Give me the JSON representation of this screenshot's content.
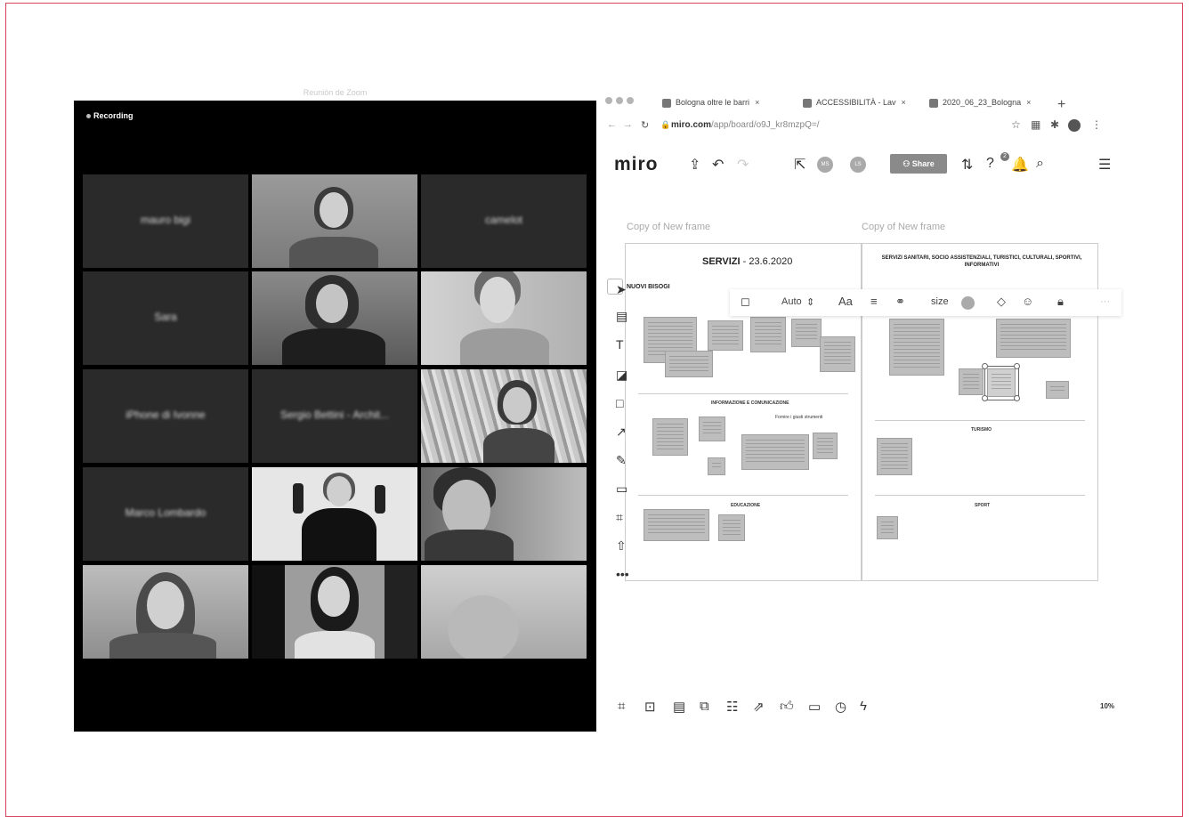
{
  "zoom": {
    "window_title": "Reunión de Zoom",
    "recording_label": "Recording",
    "participants": [
      {
        "name": "mauro bigi"
      },
      {
        "name": ""
      },
      {
        "name": "camelot"
      },
      {
        "name": "Sara"
      },
      {
        "name": ""
      },
      {
        "name": ""
      },
      {
        "name": "iPhone di Ivonne"
      },
      {
        "name": "Sergio Bettini - Archit..."
      },
      {
        "name": ""
      },
      {
        "name": "Marco Lombardo"
      },
      {
        "name": ""
      },
      {
        "name": ""
      },
      {
        "name": ""
      },
      {
        "name": ""
      },
      {
        "name": ""
      }
    ]
  },
  "browser": {
    "tabs": [
      {
        "label": "Bologna oltre le barri",
        "close": "×"
      },
      {
        "label": "ACCESSIBILITÀ - Lav",
        "close": "×"
      },
      {
        "label": "2020_06_23_Bologna",
        "close": "×"
      }
    ],
    "new_tab": "+",
    "url_domain": "miro.com",
    "url_path": "/app/board/o9J_kr8mzpQ=/"
  },
  "miro": {
    "logo": "miro",
    "share_label": "Share",
    "avatar_initials": [
      "MS",
      "LS"
    ],
    "notification_count": "2",
    "frames": [
      {
        "title": "Copy of New frame",
        "heading_bold": "SERVIZI",
        "heading_rest": " - 23.6.2020",
        "nuovi": "NUOVI BISOGI",
        "sections": [
          "INFORMAZIONE E COMUNICAZIONE",
          "Fornire i giusti strumenti",
          "EDUCAZIONE"
        ]
      },
      {
        "title": "Copy of New frame",
        "heading": "SERVIZI SANITARI, SOCIO ASSISTENZIALI, TURISTICI, CULTURALI, SPORTIVI, INFORMATIVI",
        "sections": [
          "TURISMO",
          "SPORT"
        ]
      }
    ],
    "context_toolbar": {
      "font_size": "Auto",
      "font_label": "Aa",
      "size_label": "size",
      "more": "···"
    },
    "zoom_level": "10%"
  }
}
